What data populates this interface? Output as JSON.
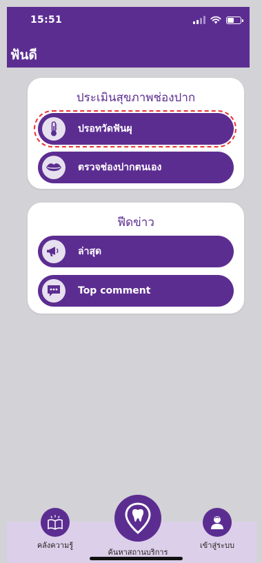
{
  "status": {
    "time": "15:51"
  },
  "app": {
    "title": "ฟันดี"
  },
  "assessment_card": {
    "title": "ประเมินสุขภาพช่องปาก",
    "items": [
      {
        "label": "ปรอทวัดฟันผุ",
        "icon": "thermometer-icon"
      },
      {
        "label": "ตรวจช่องปากตนเอง",
        "icon": "lips-icon"
      }
    ]
  },
  "feed_card": {
    "title": "ฟีดข่าว",
    "items": [
      {
        "label": "ล่าสุด",
        "icon": "megaphone-icon"
      },
      {
        "label": "Top comment",
        "icon": "comment-icon"
      }
    ]
  },
  "bottom_nav": {
    "items": [
      {
        "label": "คลังความรู้",
        "icon": "book-icon"
      },
      {
        "label": "ค้นหาสถานบริการ",
        "icon": "tooth-location-icon"
      },
      {
        "label": "เข้าสู่ระบบ",
        "icon": "user-icon"
      }
    ]
  },
  "colors": {
    "primary": "#5c2d91",
    "background": "#d3d2d7",
    "nav_background": "#dccfe9",
    "highlight": "#e8312f"
  }
}
